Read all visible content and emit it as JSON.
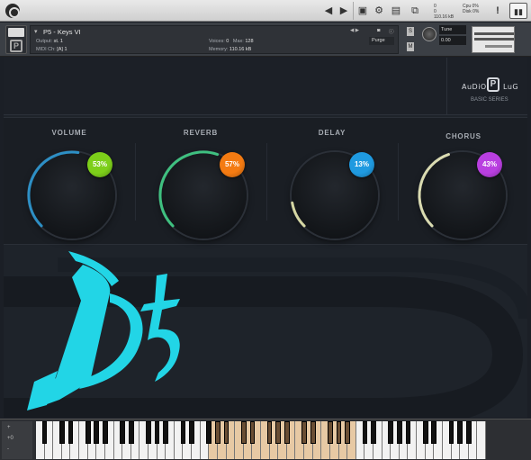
{
  "host": {
    "stats_left": [
      "0",
      "0",
      "110.16 kB"
    ],
    "stats_right": [
      "Cpu 0%",
      "Disk 0%"
    ],
    "icons": [
      "kontakt-logo-icon",
      "prev-arrow-icon",
      "next-arrow-icon",
      "save-icon",
      "gear-icon",
      "view-icon",
      "expand-icon",
      "warning-icon",
      "panel-icon"
    ]
  },
  "instrument_header": {
    "name": "P5 - Keys VI",
    "output_label": "Output:",
    "output_value": "st. 1",
    "midi_label": "MIDI Ch:",
    "midi_value": "[A] 1",
    "voices_label": "Voices:",
    "voices_value": "0",
    "max_label": "Max:",
    "max_value": "128",
    "memory_label": "Memory:",
    "memory_value": "110.16 kB",
    "purge_label": "Purge",
    "tune_label": "Tune",
    "tune_value": "0.00",
    "solo_label": "S",
    "mute_label": "M"
  },
  "brand": {
    "title_left": "AuDiO",
    "title_p": "P",
    "title_right": "LuG",
    "subtitle": "BASIC SERIES"
  },
  "effects": [
    {
      "label": "VOLUME",
      "value": "53%",
      "color": "#7dcf1a",
      "level": 0.53,
      "arc_color": "#2f9bd6"
    },
    {
      "label": "REVERB",
      "value": "57%",
      "color": "#f47b12",
      "level": 0.57,
      "arc_color": "#43d28a"
    },
    {
      "label": "DELAY",
      "value": "13%",
      "color": "#1f9ae0",
      "level": 0.13,
      "arc_color": "#e9eab0"
    },
    {
      "label": "CHORUS",
      "value": "43%",
      "color": "#b93fe0",
      "level": 0.43,
      "arc_color": "#eef0c0"
    }
  ],
  "logo": {
    "text": "P5",
    "color": "#22d5e6"
  },
  "keyboard": {
    "side_top": "+",
    "side_mid": "+0",
    "side_bot": "-",
    "highlight_color": "#e7c9a4"
  }
}
